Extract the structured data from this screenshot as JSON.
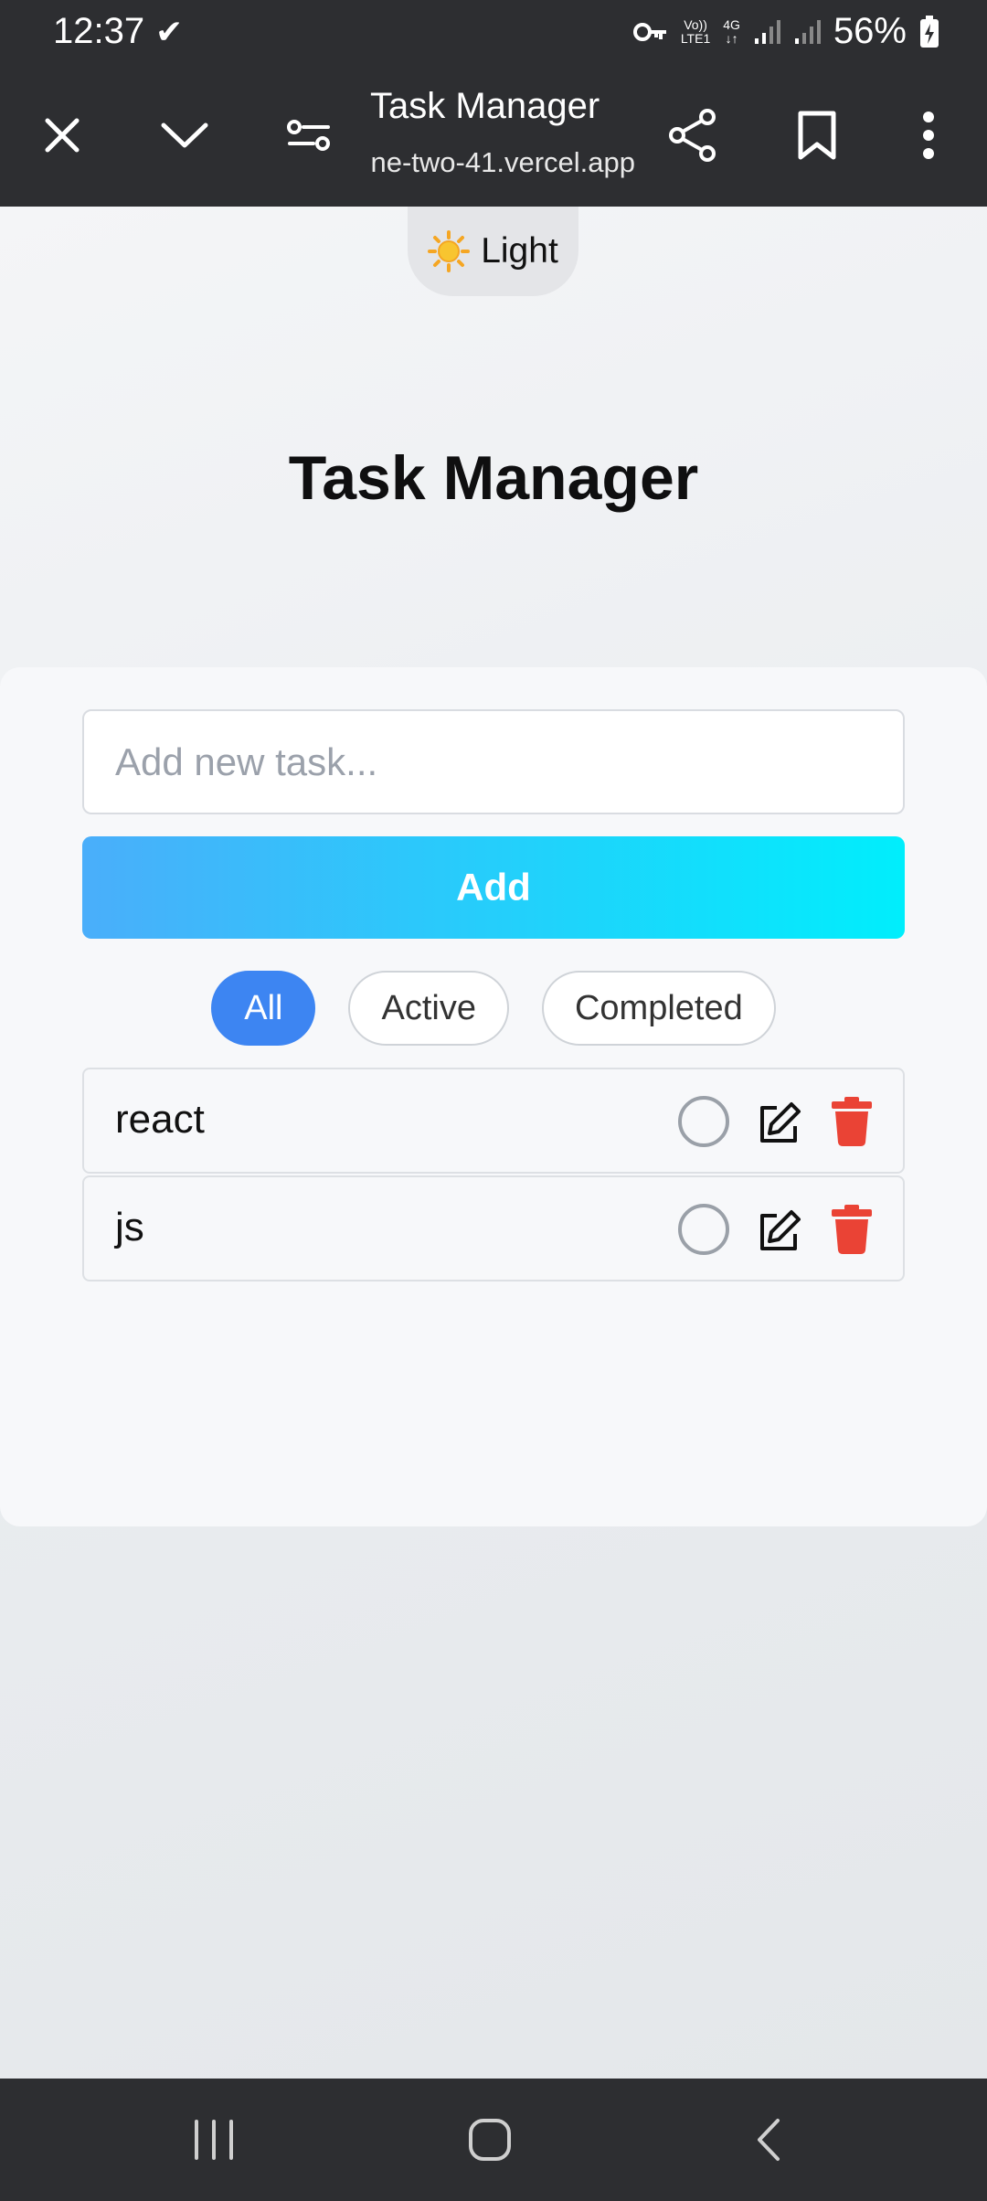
{
  "status_bar": {
    "time": "12:37",
    "carrier_line1": "Vo))",
    "carrier_line2": "LTE1",
    "network": "4G",
    "battery": "56%"
  },
  "browser": {
    "title": "Task Manager",
    "url": "ne-two-41.vercel.app"
  },
  "theme_toggle": {
    "icon": "sun-icon",
    "label": "Light"
  },
  "page": {
    "title": "Task Manager"
  },
  "input": {
    "placeholder": "Add new task...",
    "value": ""
  },
  "add_button": {
    "label": "Add"
  },
  "filters": [
    {
      "label": "All",
      "active": true
    },
    {
      "label": "Active",
      "active": false
    },
    {
      "label": "Completed",
      "active": false
    }
  ],
  "tasks": [
    {
      "text": "react",
      "completed": false
    },
    {
      "text": "js",
      "completed": false
    }
  ],
  "colors": {
    "accent": "#3d85f2",
    "gradient_start": "#4aaefa",
    "gradient_end": "#00eefc",
    "delete": "#ea4335"
  }
}
